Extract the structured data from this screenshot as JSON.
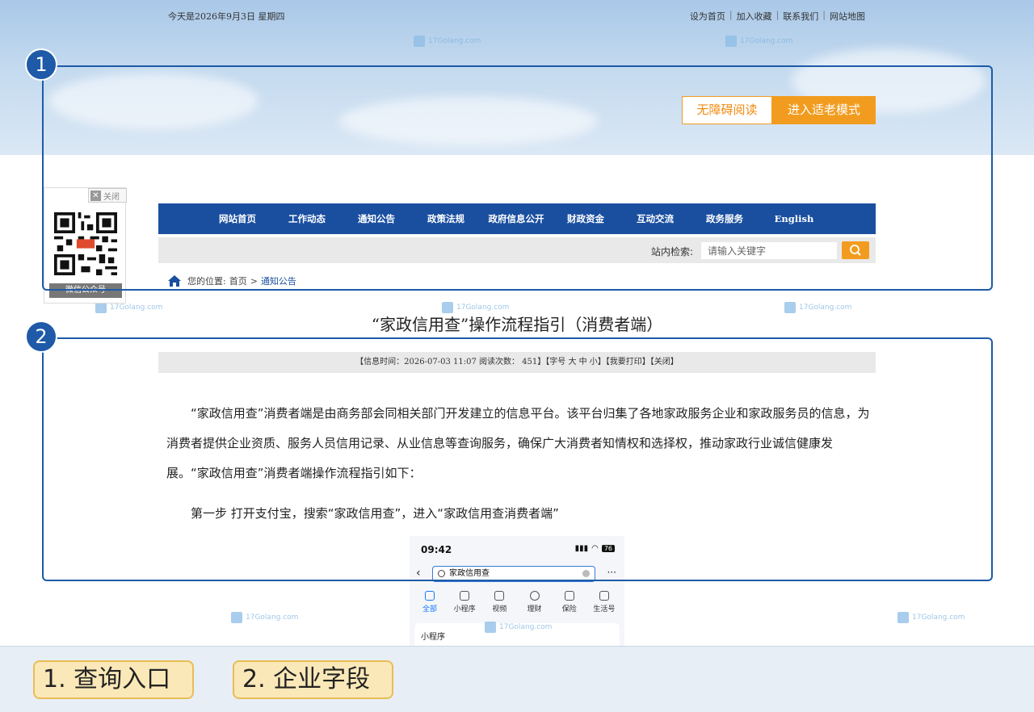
{
  "header": {
    "date_text": "今天是2026年9月3日 星期四",
    "top_links": [
      "设为首页",
      "加入收藏",
      "联系我们",
      "网站地图"
    ],
    "separator": "|",
    "accessibility_button": "无障碍阅读",
    "elder_mode_button": "进入适老模式"
  },
  "nav": {
    "items": [
      "网站首页",
      "工作动态",
      "通知公告",
      "政策法规",
      "政府信息公开",
      "财政资金",
      "互动交流",
      "政务服务",
      "English"
    ]
  },
  "search": {
    "label": "站内检索:",
    "placeholder": "请输入关键字"
  },
  "breadcrumb": {
    "prefix": "您的位置:",
    "home": "首页",
    "separator": ">",
    "current": "通知公告"
  },
  "qr_panel": {
    "close_label": "关闭",
    "caption": "微信公众号"
  },
  "watermark": {
    "text": "17Golang.com"
  },
  "article": {
    "title": "“家政信用查”操作流程指引（消费者端）",
    "info_bar": "【信息时间：2026-07-03 11:07  阅读次数：  451】【字号 大 中 小】【我要打印】【关闭】",
    "paragraph_1": "“家政信用查”消费者端是由商务部会同相关部门开发建立的信息平台。该平台归集了各地家政服务企业和家政服务员的信息，为消费者提供企业资质、服务人员信用记录、从业信息等查询服务，确保广大消费者知情权和选择权，推动家政行业诚信健康发展。“家政信用查”消费者端操作流程指引如下：",
    "step_1": "第一步    打开支付宝，搜索“家政信用查”，进入“家政信用查消费者端”"
  },
  "phone": {
    "time": "09:42",
    "battery": "76",
    "search_text": "家政信用查",
    "more": "···",
    "tabs": [
      "全部",
      "小程序",
      "视频",
      "理财",
      "保险",
      "生活号"
    ],
    "card_title": "小程序"
  },
  "callouts": {
    "badge_1": "1",
    "badge_2": "2"
  },
  "footer": {
    "legend_1": "1. 查询入口",
    "legend_2": "2. 企业字段"
  },
  "colors": {
    "nav_blue": "#1a4fa0",
    "accent_orange": "#f29c1f",
    "callout_blue": "#1e5aa8",
    "chip_fill": "#fbe8b8"
  }
}
